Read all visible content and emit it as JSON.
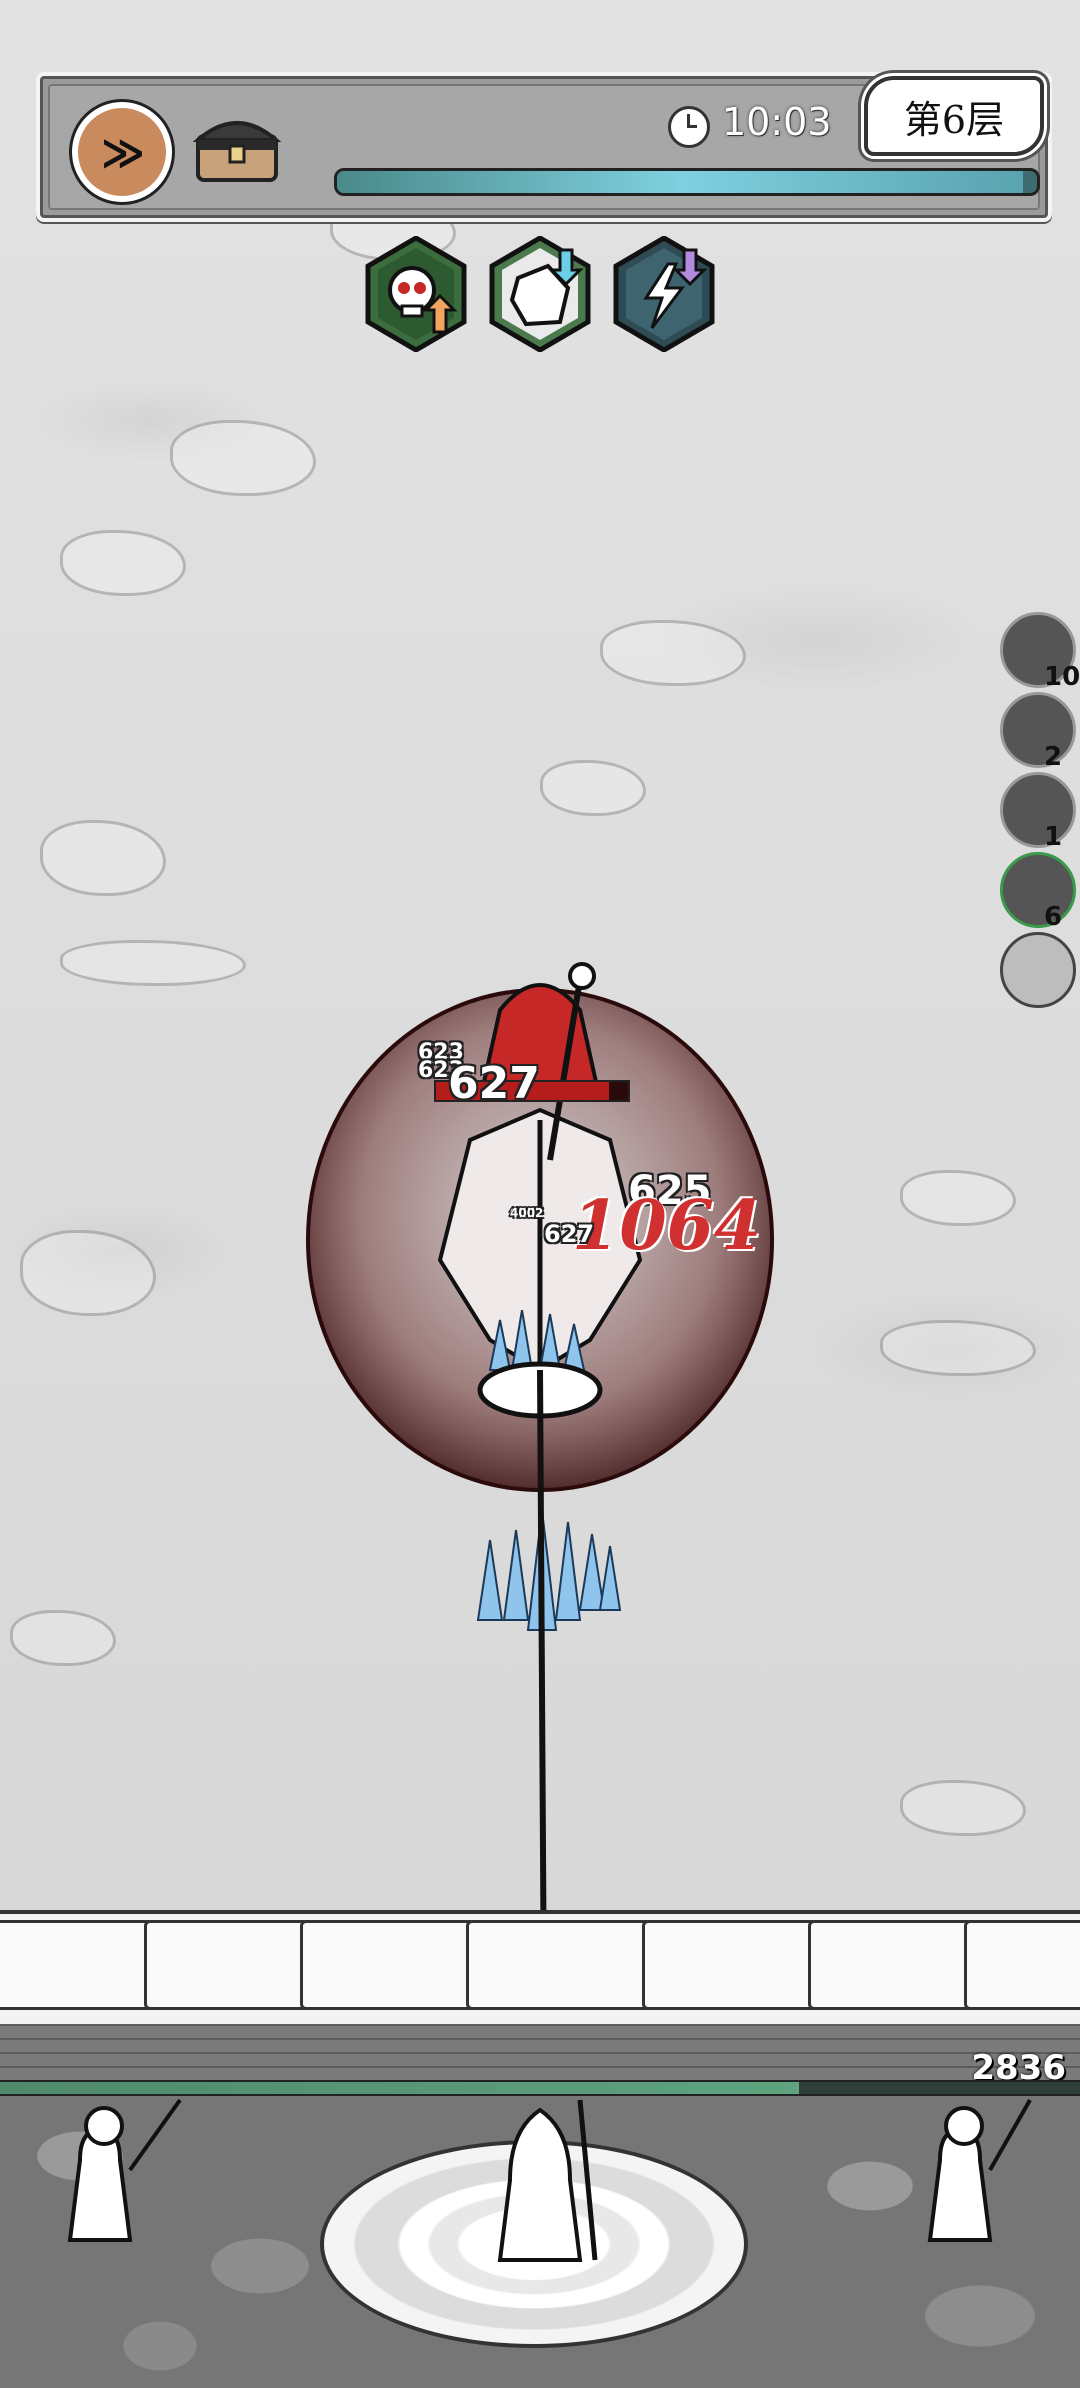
{
  "hud": {
    "speed_button_label": "≫",
    "time": "10:03",
    "floor": "第6层",
    "energy_level": 0.98
  },
  "skills": [
    {
      "name": "skull-attack-up-icon"
    },
    {
      "name": "stone-defense-down-icon"
    },
    {
      "name": "lightning-cooldown-down-icon"
    }
  ],
  "side_skills": [
    {
      "icon": "stone-skill-icon",
      "count": "10"
    },
    {
      "icon": "lightning-skill-icon",
      "count": "2"
    },
    {
      "icon": "rock-burst-skill-icon",
      "count": "1"
    },
    {
      "icon": "spear-skill-icon",
      "count": "6"
    },
    {
      "icon": "empty-slot-icon",
      "count": ""
    }
  ],
  "enemy": {
    "hp_level": 0.9
  },
  "damage_numbers": {
    "d1": "623",
    "d2": "623",
    "d3": "627",
    "d4": "625",
    "crit": "1064",
    "d5": "627",
    "d6": "4002"
  },
  "wall": {
    "hp_value": "2836",
    "hp_level": 0.74
  },
  "colors": {
    "crit": "#d03030",
    "wall_hp": "#5fa37f",
    "speed_button": "#c98b5d"
  }
}
